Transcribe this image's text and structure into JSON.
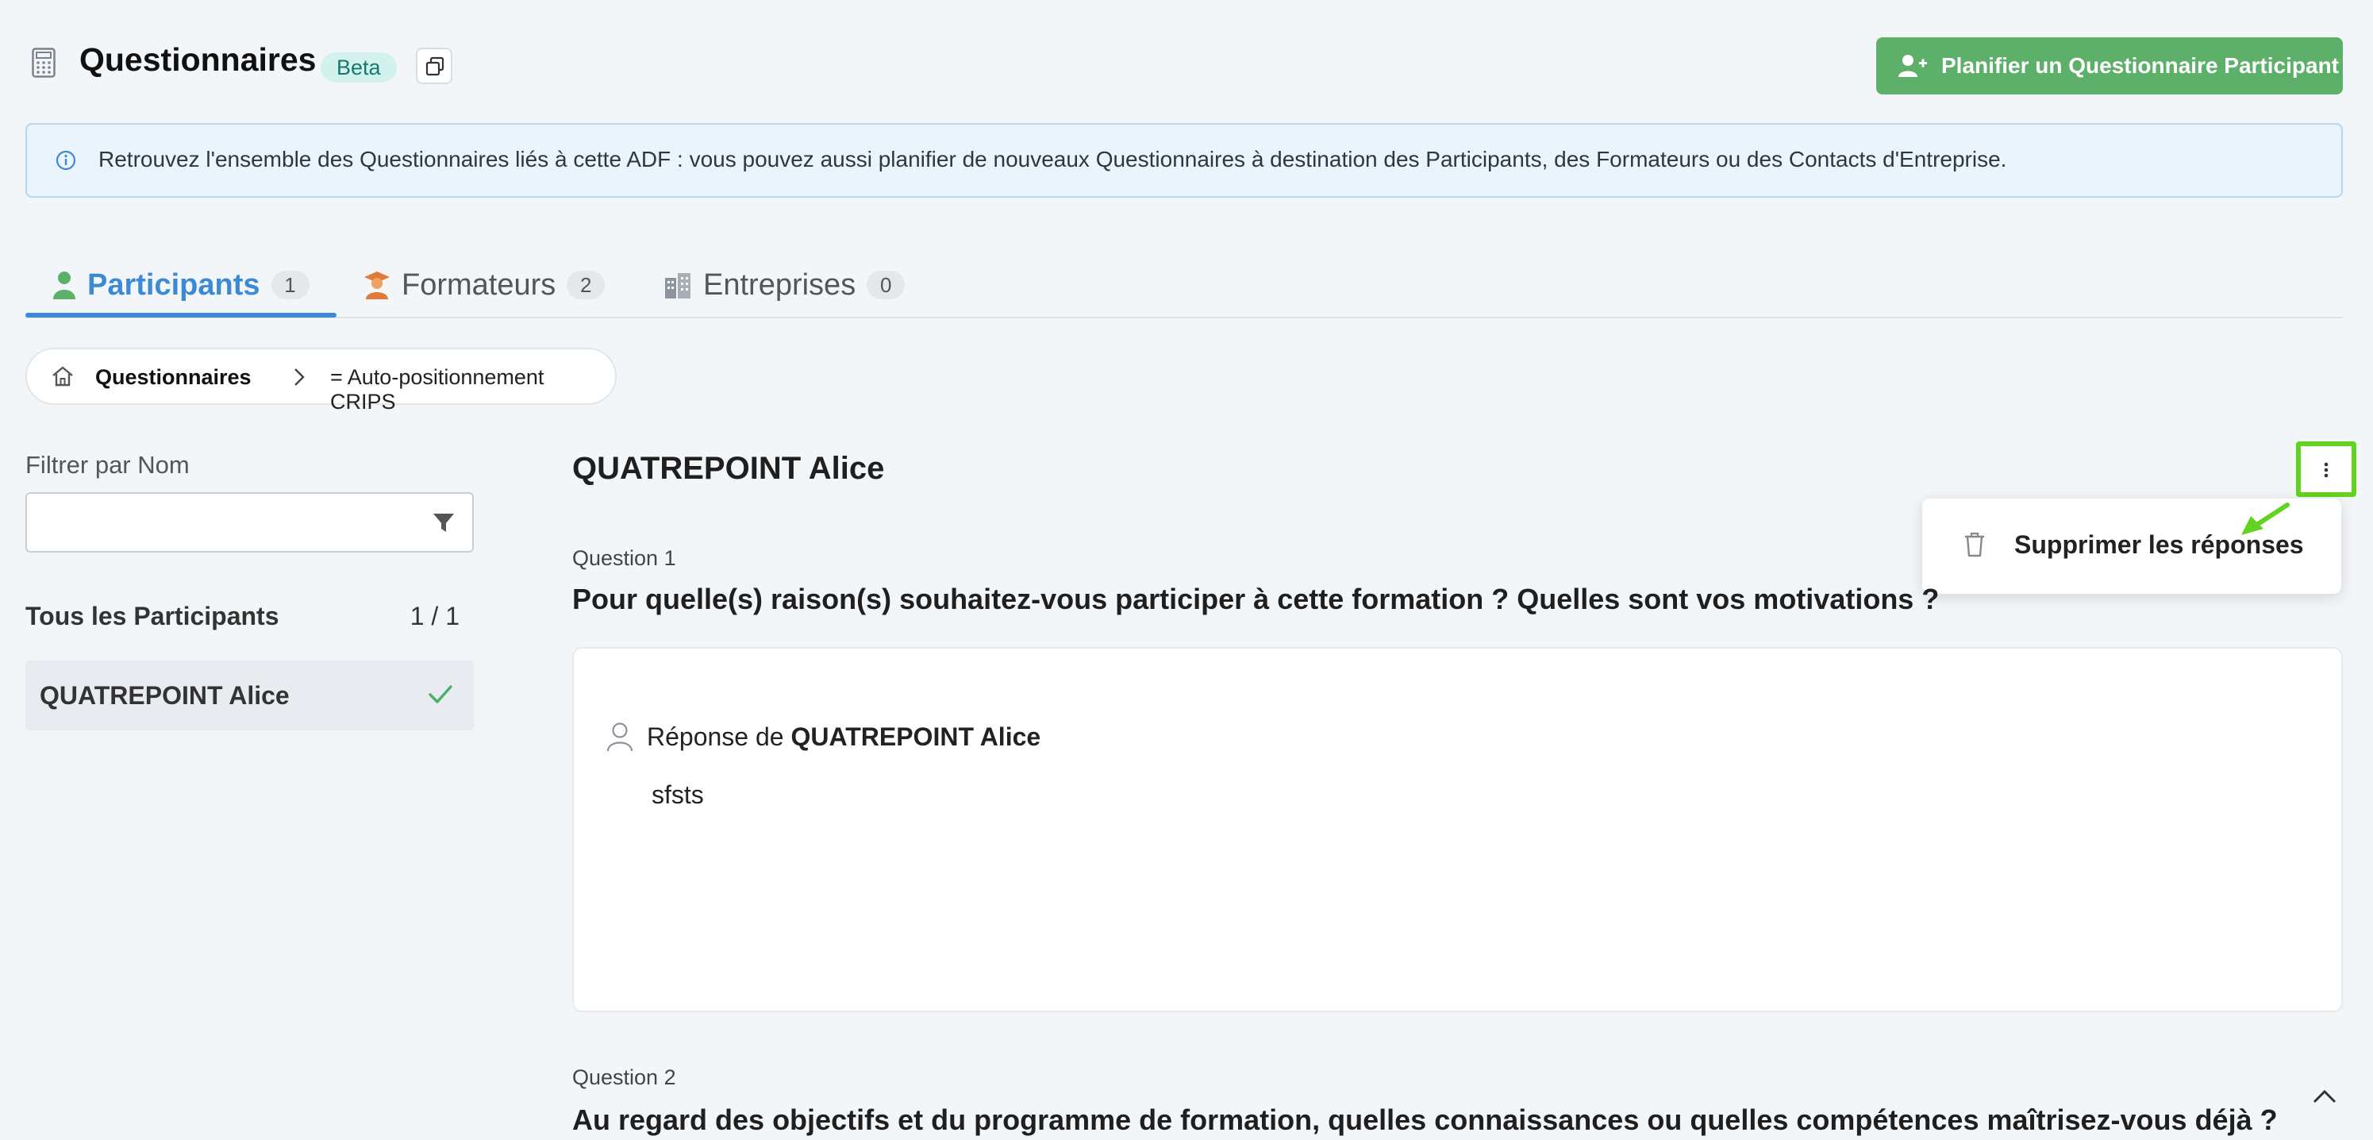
{
  "header": {
    "title": "Questionnaires",
    "badge": "Beta",
    "plan_button": "Planifier un Questionnaire Participant"
  },
  "info": {
    "text": "Retrouvez l'ensemble des Questionnaires liés à cette ADF : vous pouvez aussi planifier de nouveaux Questionnaires à destination des Participants, des Formateurs ou des Contacts d'Entreprise."
  },
  "tabs": [
    {
      "label": "Participants",
      "count": "1",
      "active": true
    },
    {
      "label": "Formateurs",
      "count": "2",
      "active": false
    },
    {
      "label": "Entreprises",
      "count": "0",
      "active": false
    }
  ],
  "breadcrumb": {
    "root": "Questionnaires",
    "current": "= Auto-positionnement CRIPS"
  },
  "filter": {
    "label": "Filtrer par Nom",
    "value": "",
    "all_label": "Tous les Participants",
    "all_count": "1 / 1",
    "items": [
      {
        "name": "QUATREPOINT Alice"
      }
    ]
  },
  "main": {
    "participant": "QUATREPOINT Alice",
    "menu": {
      "delete_label": "Supprimer les réponses"
    },
    "questions": [
      {
        "label": "Question 1",
        "text": "Pour quelle(s) raison(s) souhaitez-vous participer à cette formation ? Quelles sont vos motivations ?",
        "answer_prefix": "Réponse de",
        "answer_author": "QUATREPOINT Alice",
        "answer": "sfsts"
      },
      {
        "label": "Question 2",
        "text": "Au regard des objectifs et du programme de formation, quelles connaissances ou quelles compétences maîtrisez-vous déjà ?"
      }
    ]
  },
  "colors": {
    "accent": "#3b8ad3",
    "success": "#5cb06a",
    "highlight": "#62d41f"
  }
}
